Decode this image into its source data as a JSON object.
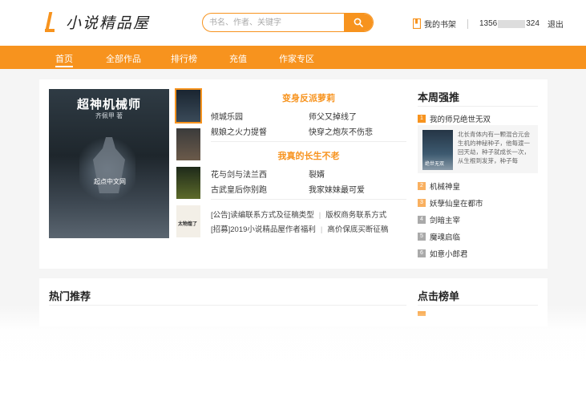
{
  "brand": {
    "logo_text": "小说精品屋",
    "accent": "#f7931e"
  },
  "search": {
    "placeholder": "书名、作者、关键字"
  },
  "user": {
    "shelf_label": "我的书架",
    "phone_prefix": "1356",
    "phone_suffix": "324",
    "logout_label": "退出"
  },
  "nav": {
    "items": [
      "首页",
      "全部作品",
      "排行榜",
      "充值",
      "作家专区"
    ],
    "active": "首页"
  },
  "featured": {
    "main_cover": {
      "title": "超神机械师",
      "author": "齐佩甲 著",
      "brand": "起点中文网"
    },
    "thumb4_title": "太物煌了",
    "sections": [
      {
        "title": "变身反派萝莉",
        "books": [
          "倾城乐园",
          "师父又掉线了",
          "舰娘之火力提督",
          "快穿之炮灰不伤悲"
        ]
      },
      {
        "title": "我真的长生不老",
        "books": [
          "花与剑与法兰西",
          "裂婿",
          "古武皇后你别跑",
          "我家妹妹最可爱"
        ]
      }
    ],
    "notices": [
      {
        "left": "[公告]读编联系方式及征稿类型",
        "right": "版权商务联系方式"
      },
      {
        "left": "[招募]2019小说精品屋作者福利",
        "right": "高价保底买断征稿"
      }
    ]
  },
  "weekly": {
    "title": "本周强推",
    "top": {
      "rank": "1",
      "name": "我的师兄绝世无双"
    },
    "feature_cover_label": "绝世无双",
    "feature_blurb": "北长青体内有一颗混合元会生机的神秘种子，他每渡一回天劫，种子就成长一次，从生根到发芽，种子每",
    "items": [
      {
        "rank": "2",
        "name": "机械神皇"
      },
      {
        "rank": "3",
        "name": "妖孽仙皇在都市"
      },
      {
        "rank": "4",
        "name": "剑暗主宰"
      },
      {
        "rank": "5",
        "name": "魔魂启临"
      },
      {
        "rank": "6",
        "name": "如意小郎君"
      }
    ]
  },
  "hot": {
    "title": "热门推荐"
  },
  "click": {
    "title": "点击榜单"
  }
}
